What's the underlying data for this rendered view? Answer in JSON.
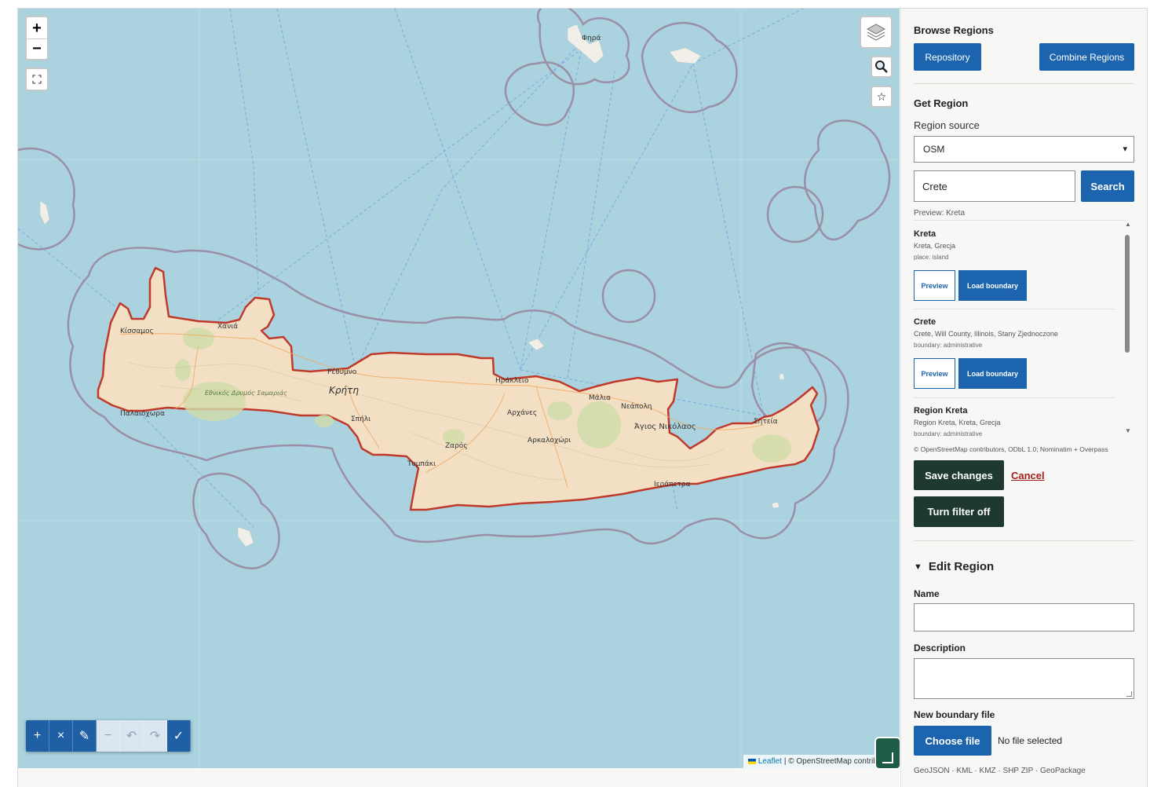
{
  "map": {
    "zoom_in": "+",
    "zoom_out": "−",
    "fullscreen_icon": "fullscreen-icon",
    "layers_icon": "layers-icon",
    "search_icon": "magnifier-icon",
    "star_icon": "☆",
    "place_labels": [
      "Φηρά",
      "Χανιά",
      "Κίσσαμος",
      "Ρέθυμνο",
      "Κρήτη",
      "Ηράκλειο",
      "Μάλια",
      "Νεάπολη",
      "Αρχάνες",
      "Σπήλι",
      "Εθνικός Δρυμός Σαμαριάς",
      "Παλαιόχωρα",
      "Ζαρός",
      "Αρκαλοχώρι",
      "Τυμπάκι",
      "Άγιος Νικόλαος",
      "Σητεία",
      "Ιεράπετρα"
    ],
    "draw_toolbar": [
      "+",
      "×",
      "✎",
      "−",
      "↶",
      "↷",
      "✓"
    ],
    "attribution_leaflet": "Leaflet",
    "attribution_rest": "| © OpenStreetMap contributors",
    "colors": {
      "sea": "#aad3df",
      "land": "#f2dfc4",
      "boundary": "#c0392b",
      "buffer": "#9b8fa8"
    }
  },
  "sidebar": {
    "browse_title": "Browse Regions",
    "repository_label": "Repository",
    "combine_label": "Combine Regions",
    "get_title": "Get Region",
    "source_label": "Region source",
    "source_value": "OSM",
    "search_value": "Crete",
    "search_button": "Search",
    "preview_text": "Preview: Kreta",
    "results": [
      {
        "title": "Kreta",
        "subtitle": "Kreta, Grecja",
        "kind": "place: island",
        "preview": "Preview",
        "load": "Load boundary"
      },
      {
        "title": "Crete",
        "subtitle": "Crete, Will County, Illinois, Stany Zjednoczone",
        "kind": "boundary: administrative",
        "preview": "Preview",
        "load": "Load boundary"
      },
      {
        "title": "Region Kreta",
        "subtitle": "Region Kreta, Kreta, Grecja",
        "kind": "boundary: administrative"
      }
    ],
    "results_attribution": "© OpenStreetMap contributors, ODbL 1.0; Nominatim + Overpass",
    "save_label": "Save changes",
    "cancel_label": "Cancel",
    "filter_label": "Turn filter off",
    "edit_title": "Edit Region",
    "name_label": "Name",
    "name_value": "",
    "description_label": "Description",
    "description_value": "",
    "file_label": "New boundary file",
    "choose_file": "Choose file",
    "no_file": "No file selected",
    "formats": "GeoJSON · KML · KMZ · SHP ZIP · GeoPackage"
  }
}
